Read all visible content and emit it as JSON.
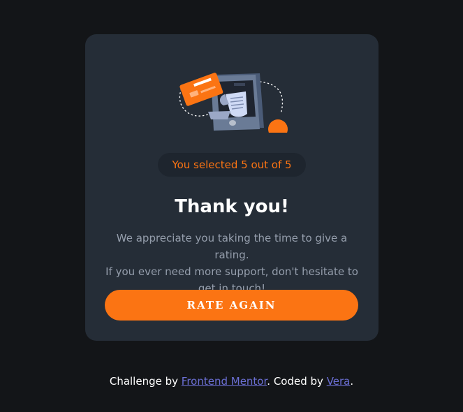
{
  "card": {
    "badge_text": "You selected 5 out of 5",
    "title": "Thank you!",
    "message_lines": [
      "We appreciate you taking the time to give a rating.",
      "If you ever need more support, don't hesitate to",
      "get in touch!"
    ],
    "button_label": "RATE AGAIN",
    "illustration_icon": "phone-payment-icon"
  },
  "attribution": {
    "prefix": "Challenge by ",
    "link1_text": "Frontend Mentor",
    "middle": ". Coded by ",
    "link2_text": "Vera",
    "suffix": "."
  },
  "colors": {
    "accent": "#fb7413",
    "card_bg": "#252d37",
    "page_bg": "#131518",
    "link": "#6b6fd4"
  }
}
